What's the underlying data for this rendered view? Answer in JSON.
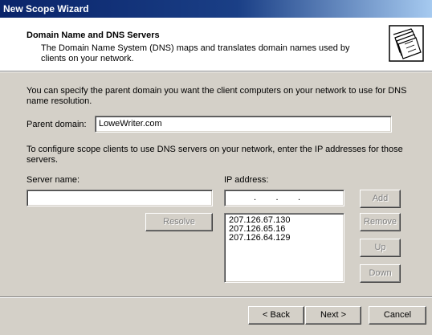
{
  "window": {
    "title": "New Scope Wizard"
  },
  "header": {
    "title": "Domain Name and DNS Servers",
    "subtitle": "The Domain Name System (DNS) maps and translates domain names used by clients on your network."
  },
  "intro_text": "You can specify the parent domain you want the client computers on your network to use for DNS name resolution.",
  "parent_domain": {
    "label": "Parent domain:",
    "value": "LoweWriter.com"
  },
  "configure_text": "To configure scope clients to use DNS servers on your network, enter the IP addresses for those servers.",
  "server_name": {
    "label": "Server name:",
    "value": ""
  },
  "ip_address": {
    "label": "IP address:",
    "dots": ".        .        ."
  },
  "buttons": {
    "add": "Add",
    "resolve": "Resolve",
    "remove": "Remove",
    "up": "Up",
    "down": "Down",
    "back": "< Back",
    "next": "Next >",
    "cancel": "Cancel"
  },
  "dns_servers": [
    "207.126.67.130",
    "207.126.65.16",
    "207.126.64.129"
  ],
  "icons": {
    "header": "folder-stack-icon"
  }
}
